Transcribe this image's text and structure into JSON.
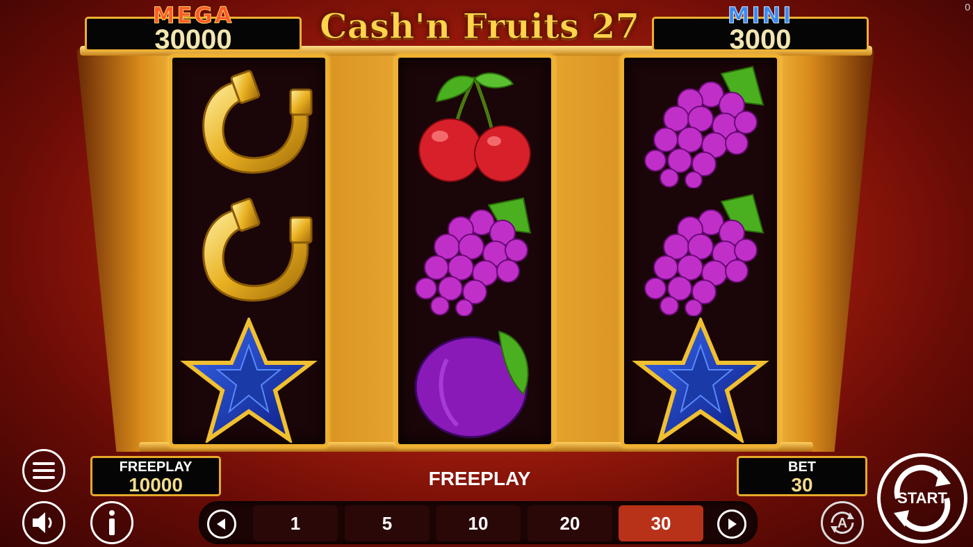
{
  "corner_counter": "0",
  "title": "Cash'n Fruits 27",
  "jackpots": {
    "mega": {
      "label": "MEGA",
      "value": "30000"
    },
    "mini": {
      "label": "MINI",
      "value": "3000"
    }
  },
  "reels": [
    {
      "symbols": [
        "horseshoe-icon",
        "horseshoe-icon",
        "blue-star-icon"
      ]
    },
    {
      "symbols": [
        "cherries-icon",
        "grapes-icon",
        "plum-icon"
      ]
    },
    {
      "symbols": [
        "grapes-icon",
        "grapes-icon",
        "blue-star-icon"
      ]
    }
  ],
  "freeplay_box": {
    "label": "FREEPLAY",
    "value": "10000"
  },
  "status_text": "FREEPLAY",
  "bet_box": {
    "label": "BET",
    "value": "30"
  },
  "bet_options": [
    "1",
    "5",
    "10",
    "20",
    "30"
  ],
  "selected_bet": "30",
  "start_label": "START",
  "colors": {
    "accent_gold": "#f0b030",
    "selected_bet": "#b8321a",
    "background_red": "#b0200e"
  }
}
